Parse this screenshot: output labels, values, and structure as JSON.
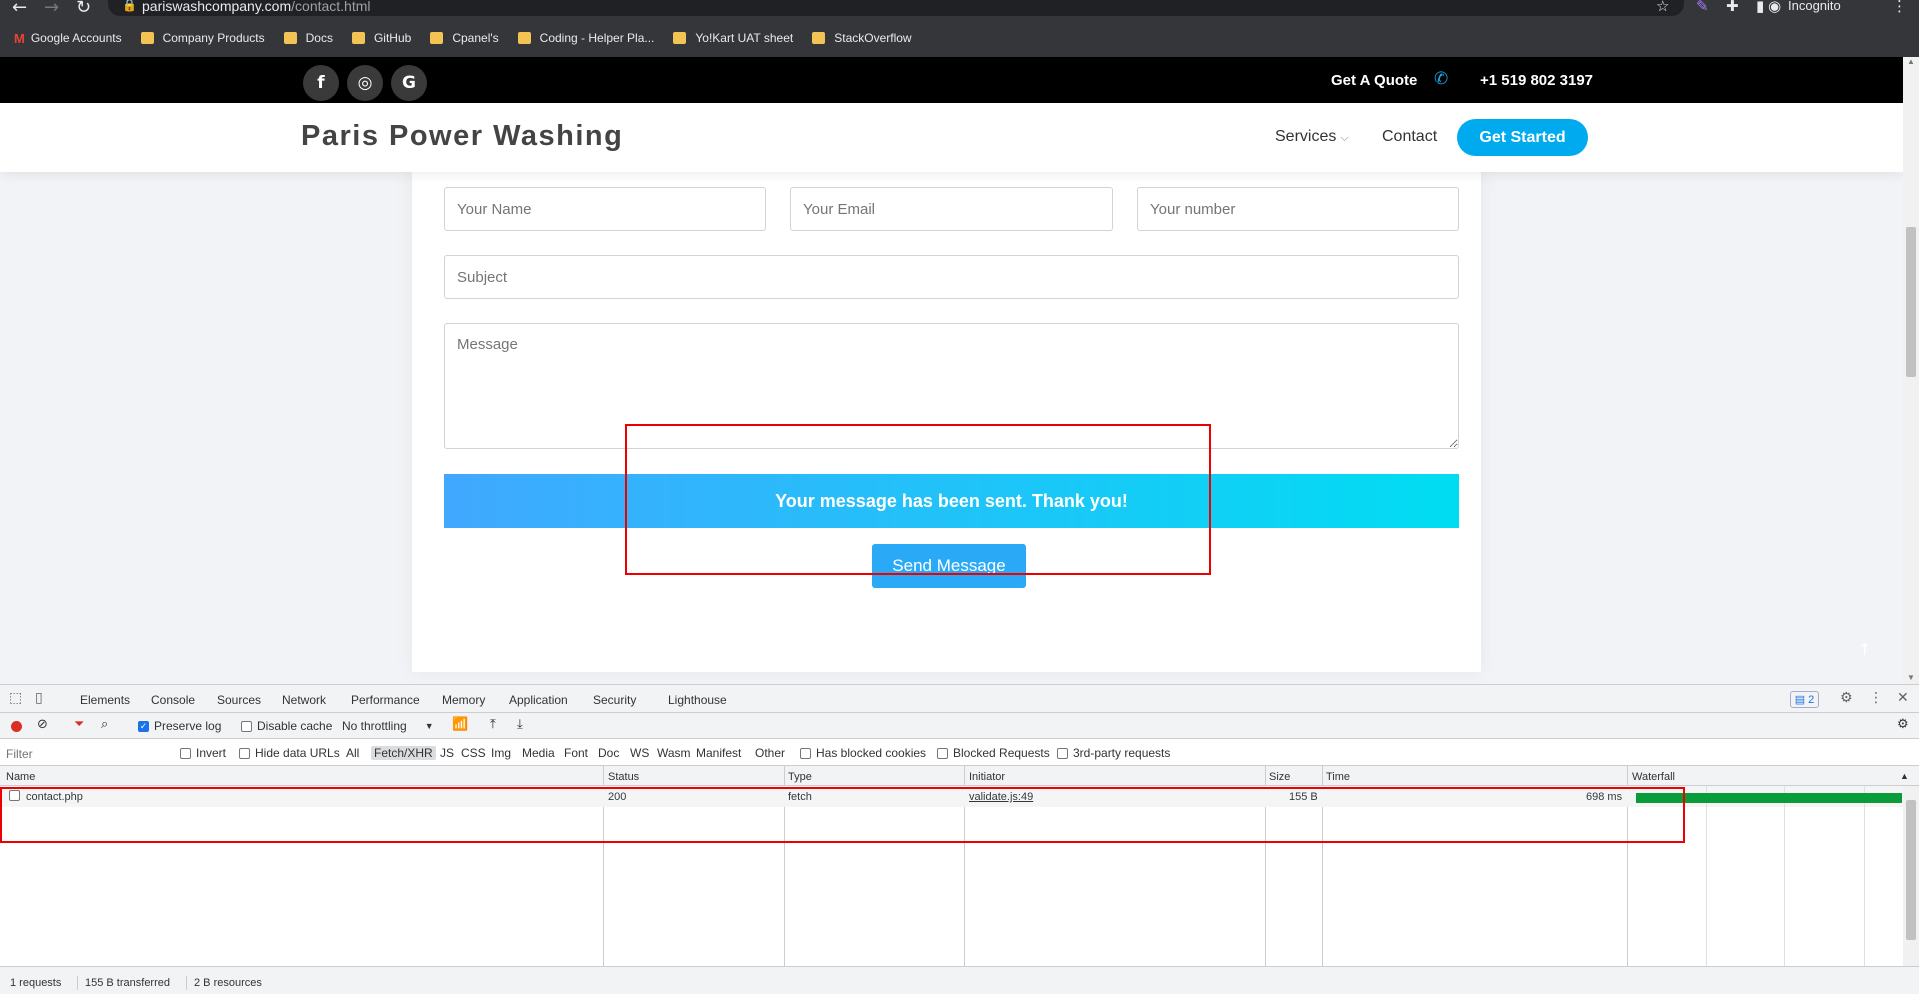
{
  "browser": {
    "url_host": "pariswashcompany.com",
    "url_path": "/contact.html",
    "incognito_label": "Incognito",
    "bookmarks": [
      "Google Accounts",
      "Company Products",
      "Docs",
      "GitHub",
      "Cpanel's",
      "Coding - Helper Pla...",
      "Yo!Kart UAT sheet",
      "StackOverflow"
    ]
  },
  "topbar": {
    "social": [
      "f",
      "◎",
      "G"
    ],
    "quote_label": "Get A Quote",
    "phone": "+1 519 802 3197"
  },
  "header": {
    "brand": "Paris Power Washing",
    "nav": [
      "Services",
      "Contact"
    ],
    "cta": "Get Started"
  },
  "form": {
    "name_placeholder": "Your Name",
    "email_placeholder": "Your Email",
    "number_placeholder": "Your number",
    "subject_placeholder": "Subject",
    "message_placeholder": "Message",
    "sent_message": "Your message has been sent. Thank you!",
    "send_button": "Send Message"
  },
  "devtools": {
    "tabs": [
      "Elements",
      "Console",
      "Sources",
      "Network",
      "Performance",
      "Memory",
      "Application",
      "Security",
      "Lighthouse"
    ],
    "active_tab": "Network",
    "issues_count": "2",
    "toolbar": {
      "preserve_log": "Preserve log",
      "disable_cache": "Disable cache",
      "throttling": "No throttling"
    },
    "filter": {
      "placeholder": "Filter",
      "invert": "Invert",
      "hide_data_urls": "Hide data URLs",
      "types": [
        "All",
        "Fetch/XHR",
        "JS",
        "CSS",
        "Img",
        "Media",
        "Font",
        "Doc",
        "WS",
        "Wasm",
        "Manifest",
        "Other"
      ],
      "active_type": "Fetch/XHR",
      "has_blocked_cookies": "Has blocked cookies",
      "blocked_requests": "Blocked Requests",
      "third_party": "3rd-party requests"
    },
    "columns": [
      "Name",
      "Status",
      "Type",
      "Initiator",
      "Size",
      "Time",
      "Waterfall"
    ],
    "rows": [
      {
        "name": "contact.php",
        "status": "200",
        "type": "fetch",
        "initiator": "validate.js:49",
        "size": "155 B",
        "time": "698 ms"
      }
    ],
    "status": {
      "requests": "1 requests",
      "transferred": "155 B transferred",
      "resources": "2 B resources"
    }
  },
  "colors": {
    "accent": "#00aaee",
    "highlight": "#ee0000",
    "waterfall": "#0a9c3b"
  }
}
